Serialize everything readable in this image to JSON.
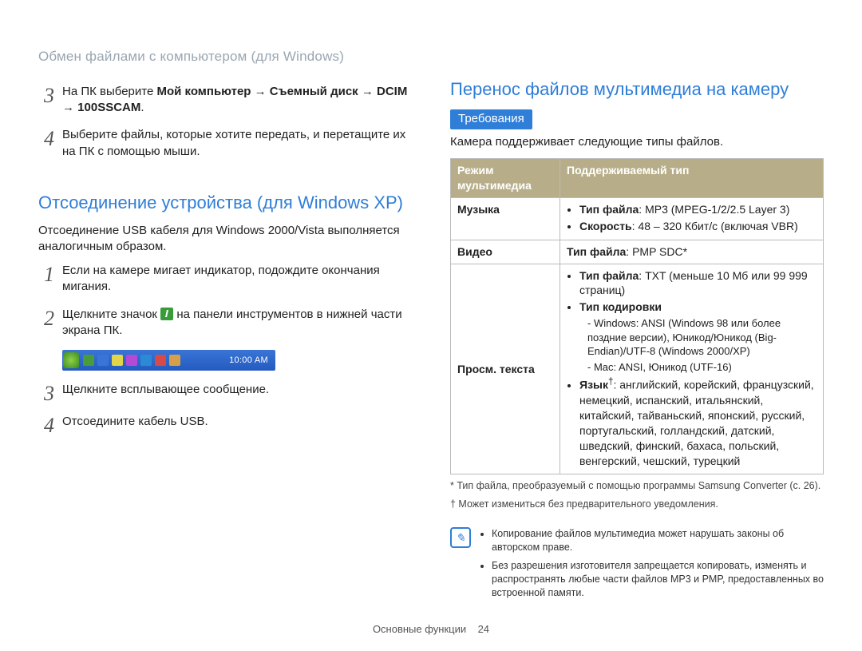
{
  "header": "Обмен файлами с компьютером (для Windows)",
  "left": {
    "step3_prefix": "На ПК выберите ",
    "step3_bold": "Мой компьютер → Съемный диск → DCIM → 100SSCAM",
    "step3_suffix": ".",
    "step4": "Выберите файлы, которые хотите передать, и перетащите их на ПК с помощью мыши.",
    "h2": "Отсоединение устройства (для Windows XP)",
    "h2_note": "Отсоединение USB кабеля для Windows 2000/Vista выполняется аналогичным образом.",
    "d_step1": "Если на камере мигает индикатор, подождите окончания мигания.",
    "d_step2_a": "Щелкните значок ",
    "d_step2_b": " на панели инструментов в нижней части экрана ПК.",
    "taskbar_clock": "10:00 AM",
    "d_step3": "Щелкните всплывающее сообщение.",
    "d_step4": "Отсоедините кабель USB."
  },
  "right": {
    "h2": "Перенос файлов мультимедиа на камеру",
    "req_label": "Требования",
    "req_intro": "Камера поддерживает следующие типы файлов.",
    "th_mode": "Режим мультимедиа",
    "th_type": "Поддерживаемый тип",
    "row_music_label": "Музыка",
    "row_music_type_label": "Тип файла",
    "row_music_type_val": ": MP3 (MPEG-1/2/2.5 Layer 3)",
    "row_music_rate_label": "Скорость",
    "row_music_rate_val": ": 48 – 320 Кбит/с (включая VBR)",
    "row_video_label": "Видео",
    "row_video_type_label": "Тип файла",
    "row_video_type_val": ": PMP SDC*",
    "row_text_label": "Просм. текста",
    "row_text_type_label": "Тип файла",
    "row_text_type_val": ": TXT (меньше 10 Мб или 99 999 страниц)",
    "row_text_enc_label": "Тип кодировки",
    "row_text_enc_win": "Windows: ANSI (Windows 98 или более поздние версии), Юникод/Юникод (Big-Endian)/UTF-8 (Windows 2000/XP)",
    "row_text_enc_mac": "Mac: ANSI, Юникод (UTF-16)",
    "row_text_lang_label": "Язык",
    "row_text_lang_sup": "†",
    "row_text_lang_val": ": английский, корейский, французский, немецкий, испанский, итальянский, китайский, тайваньский, японский, русский, португальский, голландский, датский, шведский, финский, бахаса, польский, венгерский, чешский, турецкий",
    "foot_star": "* Тип файла, преобразуемый с помощью программы Samsung Converter (с. 26).",
    "foot_dagger": "† Может измениться без предварительного уведомления.",
    "tip1": "Копирование файлов мультимедиа может нарушать законы об авторском праве.",
    "tip2": "Без разрешения изготовителя запрещается копировать, изменять и распространять любые части файлов MP3 и PMP, предоставленных во встроенной памяти."
  },
  "footer": {
    "section": "Основные функции",
    "page": "24"
  },
  "nums": {
    "n1": "1",
    "n2": "2",
    "n3": "3",
    "n4": "4"
  }
}
